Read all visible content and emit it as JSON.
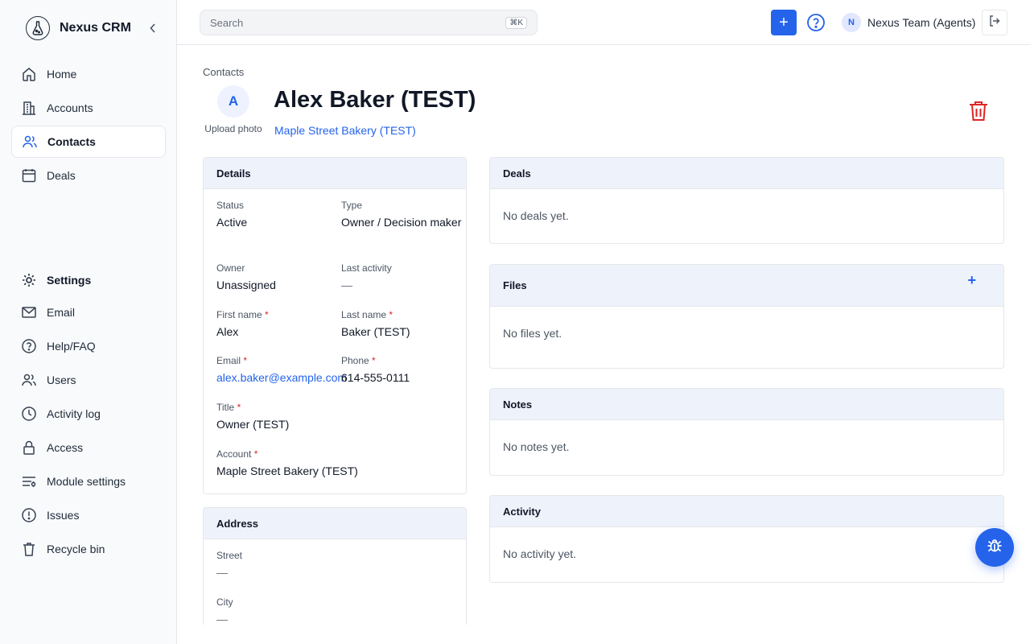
{
  "brand": {
    "name": "Nexus CRM"
  },
  "nav": {
    "primary": [
      {
        "label": "Home",
        "icon": "home-icon"
      },
      {
        "label": "Accounts",
        "icon": "building-icon"
      },
      {
        "label": "Contacts",
        "icon": "users-icon",
        "active": true
      },
      {
        "label": "Deals",
        "icon": "calendar-icon"
      }
    ],
    "settings_label": "Settings",
    "secondary": [
      {
        "label": "Email",
        "icon": "mail-icon"
      },
      {
        "label": "Help/FAQ",
        "icon": "help-circle-icon"
      },
      {
        "label": "Users",
        "icon": "users-icon"
      },
      {
        "label": "Activity log",
        "icon": "clock-icon"
      },
      {
        "label": "Access",
        "icon": "lock-icon"
      },
      {
        "label": "Module settings",
        "icon": "sliders-icon"
      },
      {
        "label": "Issues",
        "icon": "alert-circle-icon"
      },
      {
        "label": "Recycle bin",
        "icon": "trash-icon"
      }
    ]
  },
  "topbar": {
    "search_placeholder": "Search",
    "search_shortcut": "⌘K",
    "add_label": "+",
    "user_initial": "N",
    "user_name": "Nexus Team (Agents)"
  },
  "contact": {
    "breadcrumb": "Contacts",
    "avatar_initial": "A",
    "upload_label": "Upload photo",
    "name": "Alex Baker (TEST)",
    "account_link": "Maple Street Bakery (TEST)"
  },
  "details": {
    "title": "Details",
    "required_mark": "*",
    "status_label": "Status",
    "status_value": "Active",
    "type_label": "Type",
    "type_value": "Owner / Decision maker",
    "owner_label": "Owner",
    "owner_value": "Unassigned",
    "last_activity_label": "Last activity",
    "last_activity_value": "—",
    "first_name_label": "First name",
    "first_name_value": "Alex",
    "last_name_label": "Last name",
    "last_name_value": "Baker (TEST)",
    "email_label": "Email",
    "email_value": "alex.baker@example.com",
    "phone_label": "Phone",
    "phone_value": "614-555-0111",
    "title_label": "Title",
    "title_value": "Owner (TEST)",
    "account_label": "Account",
    "account_value": "Maple Street Bakery (TEST)"
  },
  "address": {
    "title": "Address",
    "street_label": "Street",
    "street_value": "—",
    "city_label": "City",
    "city_value": "—"
  },
  "deals": {
    "title": "Deals",
    "empty": "No deals yet."
  },
  "files": {
    "title": "Files",
    "add": "+",
    "empty": "No files yet."
  },
  "notes": {
    "title": "Notes",
    "empty": "No notes yet."
  },
  "activity": {
    "title": "Activity",
    "empty": "No activity yet."
  },
  "colors": {
    "accent": "#2563eb",
    "danger": "#dc2626",
    "card_header": "#eef2fb"
  }
}
